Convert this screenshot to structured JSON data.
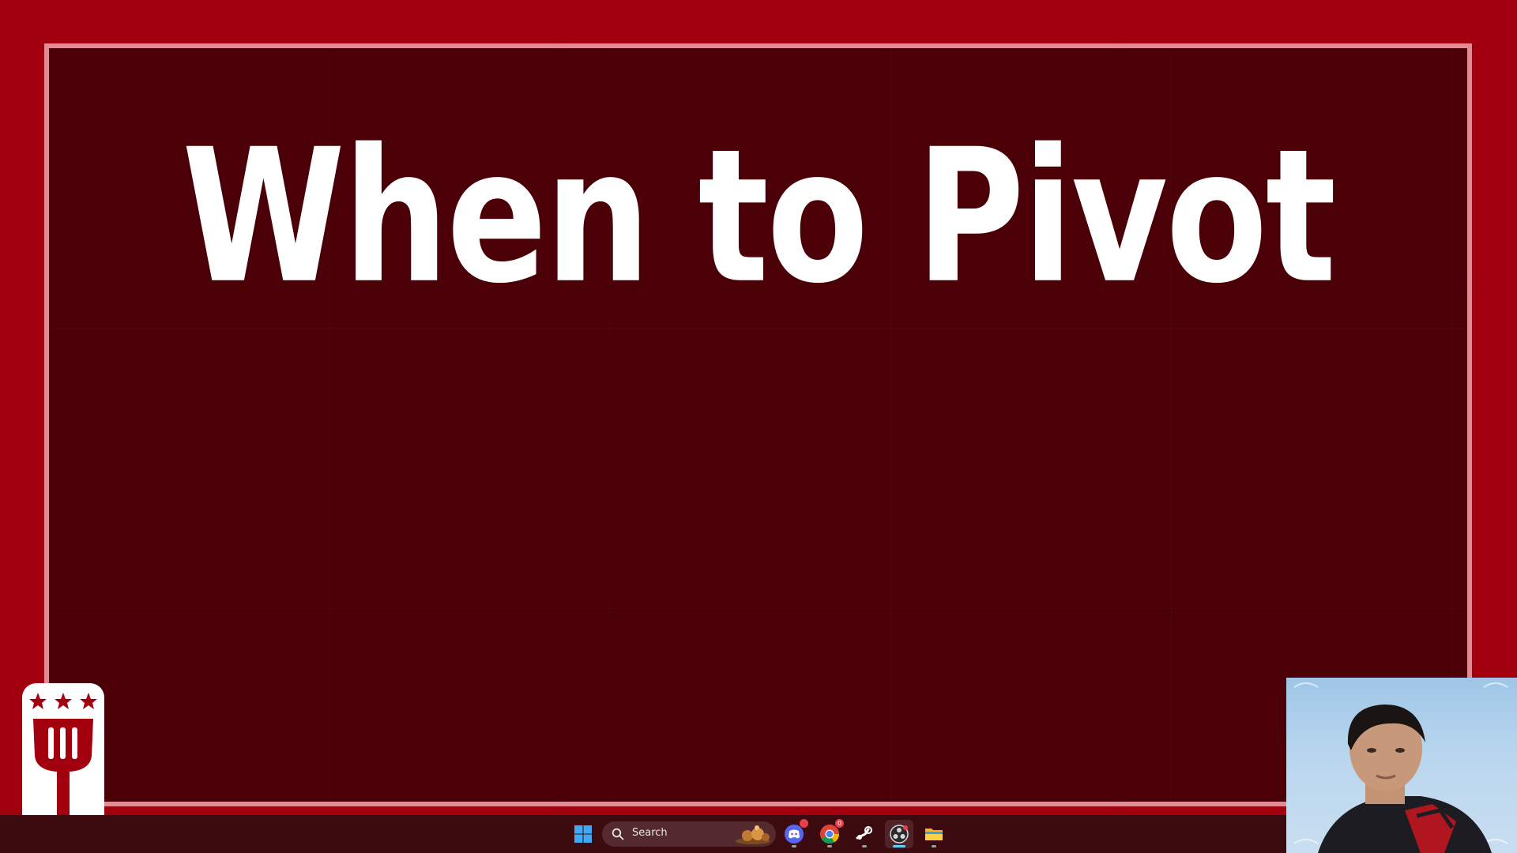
{
  "slide": {
    "title": "When to Pivot"
  },
  "taskbar": {
    "search": {
      "placeholder": "Search"
    },
    "apps": [
      {
        "name": "start",
        "icon": "windows-logo-icon"
      },
      {
        "name": "discord",
        "icon": "discord-icon"
      },
      {
        "name": "chrome",
        "icon": "chrome-icon",
        "badge": "0"
      },
      {
        "name": "steam",
        "icon": "steam-icon"
      },
      {
        "name": "obs",
        "icon": "obs-icon"
      },
      {
        "name": "file-explorer",
        "icon": "folder-icon"
      }
    ]
  },
  "colors": {
    "background": "#a3000f",
    "panel": "#4a0006",
    "panel_border": "#e58a92",
    "title_text": "#ffffff",
    "taskbar": "#3b0b10",
    "accent": "#60cdff"
  }
}
